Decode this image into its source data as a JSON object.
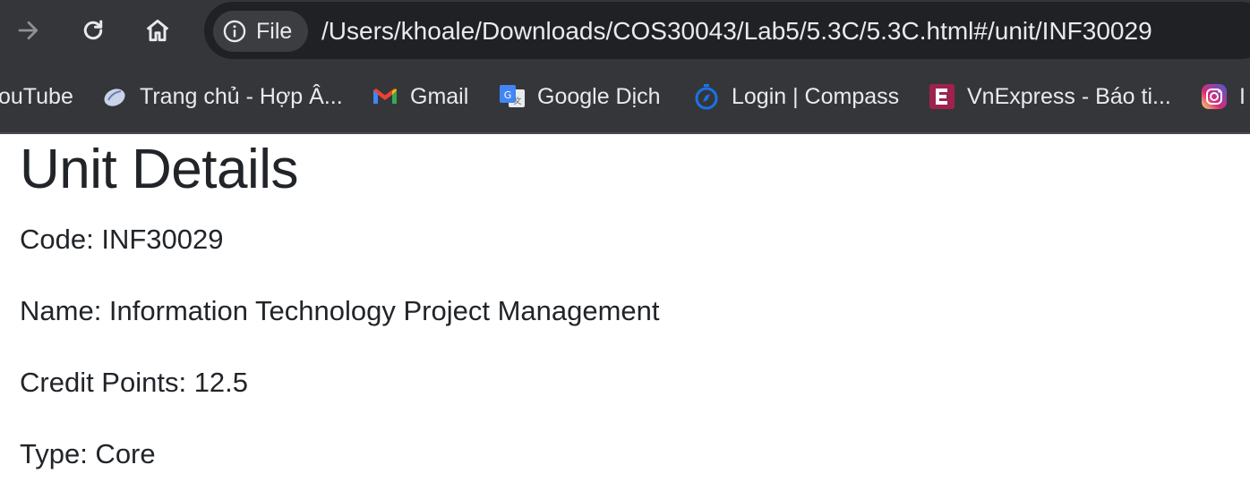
{
  "browser": {
    "chip_label": "File",
    "url": "/Users/khoale/Downloads/COS30043/Lab5/5.3C/5.3C.html#/unit/INF30029",
    "bookmarks": [
      {
        "label": "ouTube",
        "icon": "youtube-icon"
      },
      {
        "label": "Trang chủ - Hợp Â...",
        "icon": "cloud-icon"
      },
      {
        "label": "Gmail",
        "icon": "gmail-icon"
      },
      {
        "label": "Google Dịch",
        "icon": "google-translate-icon"
      },
      {
        "label": "Login | Compass",
        "icon": "compass-icon"
      },
      {
        "label": "VnExpress - Báo ti...",
        "icon": "vnexpress-icon"
      },
      {
        "label": "I",
        "icon": "instagram-icon"
      }
    ]
  },
  "unit": {
    "heading": "Unit Details",
    "code": "Code: INF30029",
    "name": "Name: Information Technology Project Management",
    "credit_points": "Credit Points: 12.5",
    "type": "Type: Core"
  },
  "colors": {
    "chrome_bg": "#35363a",
    "omnibox_bg": "#202124",
    "text_light": "#e8eaed",
    "page_text": "#212529"
  }
}
